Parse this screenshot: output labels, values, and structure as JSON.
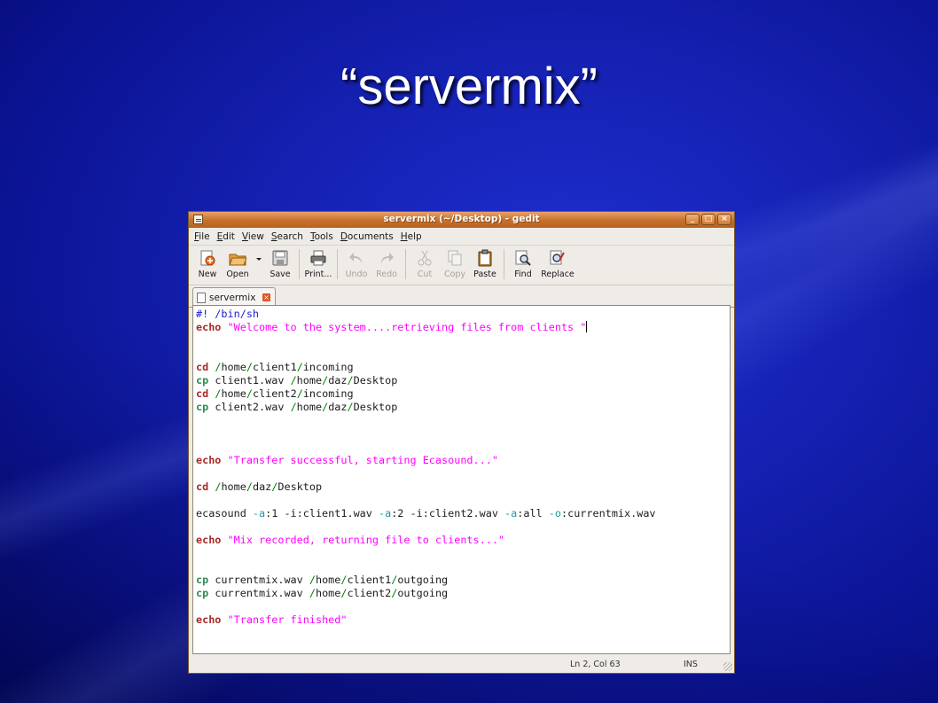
{
  "slide": {
    "title": "“servermix”"
  },
  "window": {
    "title": "servermix (~/Desktop) - gedit",
    "buttons": [
      "_",
      "□",
      "×"
    ]
  },
  "menu": [
    {
      "label": "File",
      "key": "F",
      "rest": "ile"
    },
    {
      "label": "Edit",
      "key": "E",
      "rest": "dit"
    },
    {
      "label": "View",
      "key": "V",
      "rest": "iew"
    },
    {
      "label": "Search",
      "key": "S",
      "rest": "earch"
    },
    {
      "label": "Tools",
      "key": "T",
      "rest": "ools"
    },
    {
      "label": "Documents",
      "key": "D",
      "rest": "ocuments"
    },
    {
      "label": "Help",
      "key": "H",
      "rest": "elp"
    }
  ],
  "toolbar": {
    "new": "New",
    "open": "Open",
    "save": "Save",
    "print": "Print...",
    "undo": "Undo",
    "redo": "Redo",
    "cut": "Cut",
    "copy": "Copy",
    "paste": "Paste",
    "find": "Find",
    "replace": "Replace"
  },
  "tab": {
    "label": "servermix"
  },
  "code_lines": [
    "#! /bin/sh",
    "echo \"Welcome to the system....retrieving files from clients \"",
    "",
    "",
    "cd /home/client1/incoming",
    "cp client1.wav /home/daz/Desktop",
    "cd /home/client2/incoming",
    "cp client2.wav /home/daz/Desktop",
    "",
    "",
    "",
    "echo \"Transfer successful, starting Ecasound...\"",
    "",
    "cd /home/daz/Desktop",
    "",
    "ecasound -a:1 -i:client1.wav -a:2 -i:client2.wav -a:all -o:currentmix.wav",
    "",
    "echo \"Mix recorded, returning file to clients...\"",
    "",
    "",
    "cp currentmix.wav /home/client1/outgoing",
    "cp currentmix.wav /home/client2/outgoing",
    "",
    "echo \"Transfer finished\""
  ],
  "status": {
    "position": "Ln 2, Col 63",
    "mode": "INS"
  }
}
